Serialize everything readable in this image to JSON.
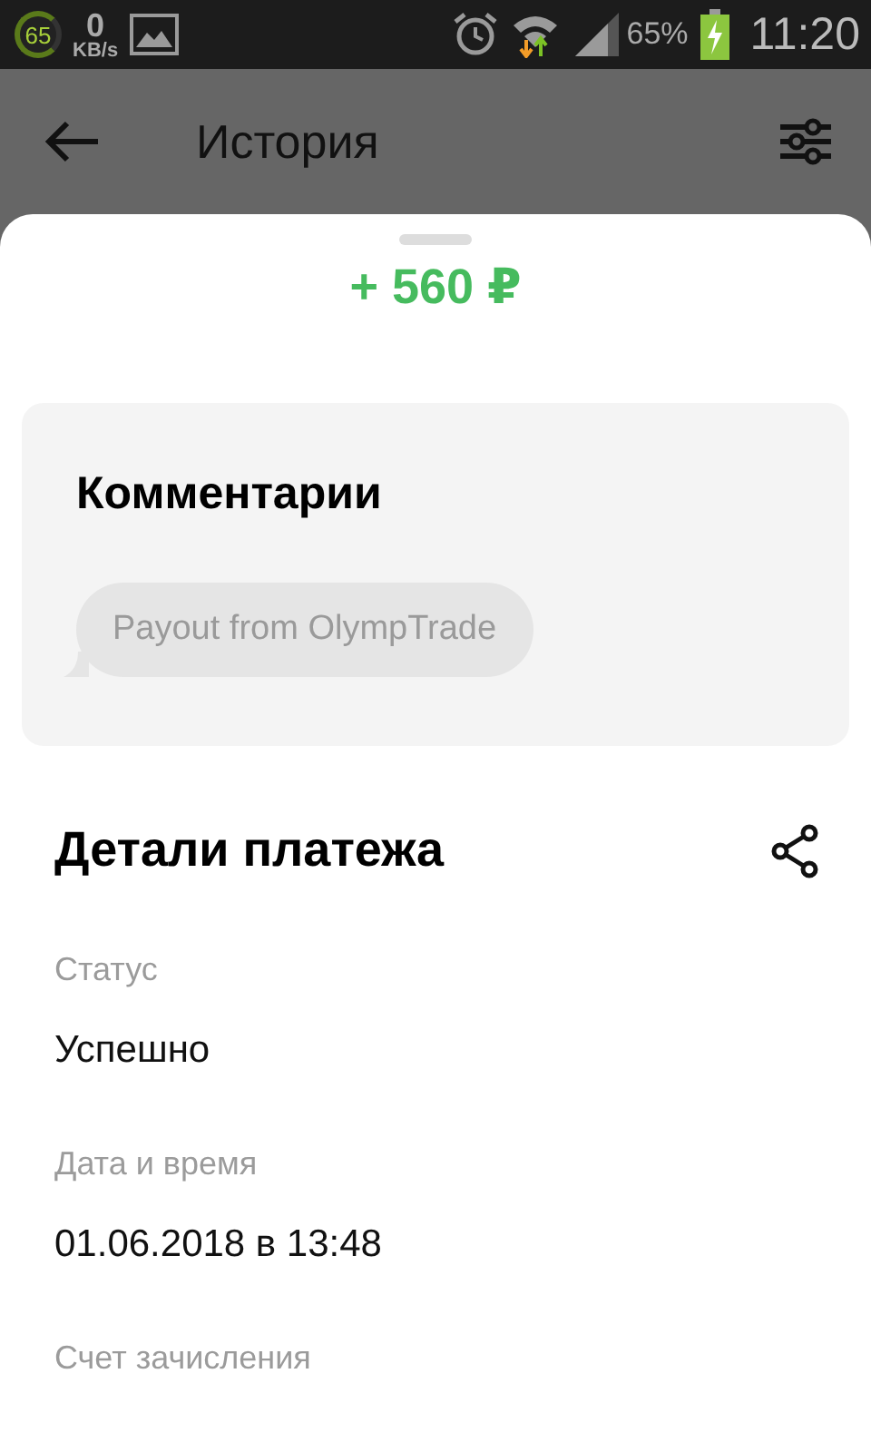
{
  "status_bar": {
    "data_ring": "65",
    "speed": "0",
    "speed_unit": "KB/s",
    "battery_percent": "65%",
    "time": "11:20"
  },
  "app_bar": {
    "title": "История"
  },
  "amount": "+ 560 ₽",
  "comments": {
    "title": "Комментарии",
    "messages": [
      "Payout from OlympTrade"
    ]
  },
  "details": {
    "title": "Детали платежа",
    "fields": [
      {
        "label": "Статус",
        "value": "Успешно"
      },
      {
        "label": "Дата и время",
        "value": "01.06.2018 в 13:48"
      },
      {
        "label": "Счет зачисления"
      }
    ]
  }
}
